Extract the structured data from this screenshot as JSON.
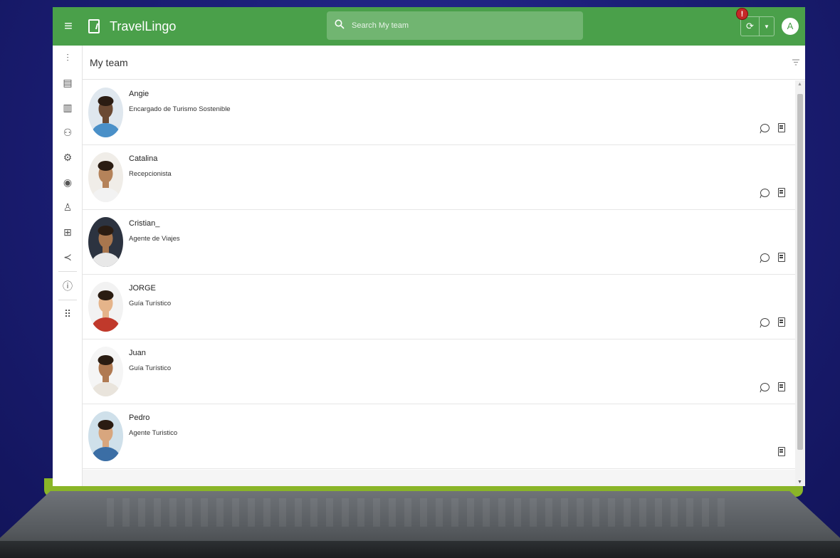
{
  "app": {
    "title": "TravelLingo",
    "accent": "#4aa04a",
    "alert_badge": "!",
    "avatar_initial": "A"
  },
  "search": {
    "placeholder": "Search My team"
  },
  "sidebar": {
    "items": [
      {
        "icon": "analytics-icon",
        "glyph": "⫶"
      },
      {
        "icon": "document-icon",
        "glyph": "▤"
      },
      {
        "icon": "library-icon",
        "glyph": "▥"
      },
      {
        "icon": "team-icon",
        "glyph": "⚇"
      },
      {
        "icon": "settings-icon",
        "glyph": "⚙"
      },
      {
        "icon": "toggle-icon",
        "glyph": "◉"
      },
      {
        "icon": "user-icon",
        "glyph": "♙"
      },
      {
        "icon": "org-chart-icon",
        "glyph": "⊞"
      },
      {
        "icon": "share-icon",
        "glyph": "≺"
      },
      {
        "icon": "info-icon",
        "glyph": "ⓘ"
      },
      {
        "icon": "apps-grid-icon",
        "glyph": "⠿"
      }
    ]
  },
  "main": {
    "title": "My team"
  },
  "members": [
    {
      "name": "Angie",
      "role": "Encargado de Turismo Sostenible",
      "skin": "#6b4a33",
      "bg": "#dfe7ee",
      "shirt": "#4a90c8",
      "has_chat": true
    },
    {
      "name": "Catalina",
      "role": "Recepcionista",
      "skin": "#b5835a",
      "bg": "#f0ede8",
      "shirt": "#f2f2f2",
      "has_chat": true
    },
    {
      "name": "Cristian_",
      "role": "Agente de Viajes",
      "skin": "#a8764e",
      "bg": "#2c3340",
      "shirt": "#e8e8e8",
      "has_chat": true
    },
    {
      "name": "JORGE",
      "role": "Guía Turístico",
      "skin": "#e5b48a",
      "bg": "#f2f2f2",
      "shirt": "#c0392b",
      "has_chat": true
    },
    {
      "name": "Juan",
      "role": "Guía Turístico",
      "skin": "#b07a52",
      "bg": "#f5f5f5",
      "shirt": "#e9e4dc",
      "has_chat": true
    },
    {
      "name": "Pedro",
      "role": "Agente Turistico",
      "skin": "#d8a67e",
      "bg": "#cfe0ea",
      "shirt": "#3b6ea5",
      "has_chat": false
    }
  ]
}
